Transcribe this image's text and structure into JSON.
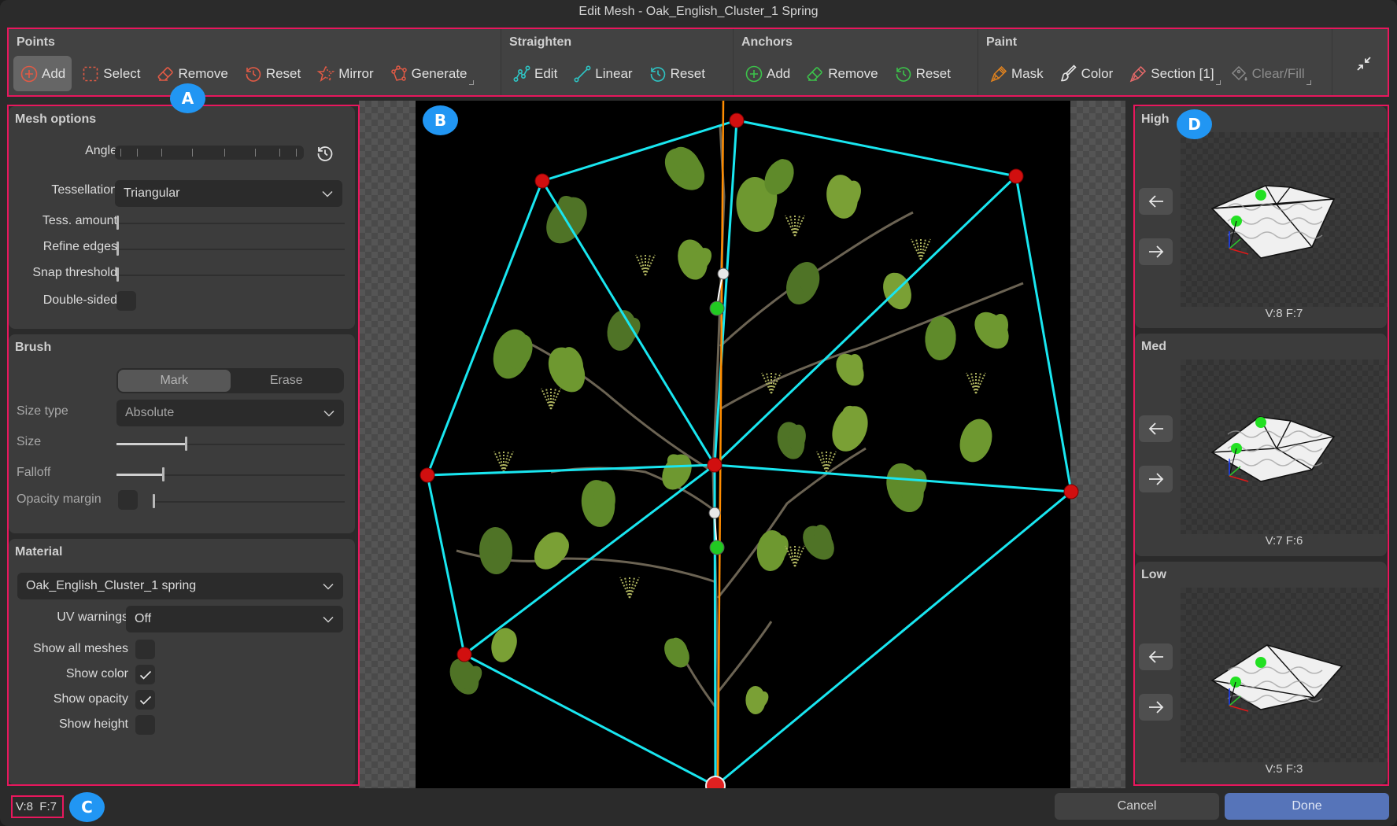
{
  "window": {
    "title": "Edit Mesh - Oak_English_Cluster_1 Spring"
  },
  "toolbar": {
    "groups": [
      {
        "title": "Points",
        "color": "#e05a45",
        "buttons": [
          {
            "label": "Add",
            "icon": "plus-circle-icon",
            "active": true
          },
          {
            "label": "Select",
            "icon": "dashed-select-icon"
          },
          {
            "label": "Remove",
            "icon": "eraser-icon"
          },
          {
            "label": "Reset",
            "icon": "history-icon"
          },
          {
            "label": "Mirror",
            "icon": "mirror-star-icon"
          },
          {
            "label": "Generate",
            "icon": "polygon-nodes-icon",
            "has_menu": true
          }
        ]
      },
      {
        "title": "Straighten",
        "color": "#2ec4c4",
        "buttons": [
          {
            "label": "Edit",
            "icon": "curve-nodes-icon"
          },
          {
            "label": "Linear",
            "icon": "line-nodes-icon"
          },
          {
            "label": "Reset",
            "icon": "history-icon"
          }
        ]
      },
      {
        "title": "Anchors",
        "color": "#3cc24a",
        "buttons": [
          {
            "label": "Add",
            "icon": "plus-circle-icon"
          },
          {
            "label": "Remove",
            "icon": "eraser-icon"
          },
          {
            "label": "Reset",
            "icon": "history-icon"
          }
        ]
      },
      {
        "title": "Paint",
        "buttons": [
          {
            "label": "Mask",
            "icon": "brush-icon",
            "color": "#e0821e"
          },
          {
            "label": "Color",
            "icon": "pen-brush-icon",
            "color": "#e8e8e8"
          },
          {
            "label": "Section [1]",
            "icon": "brush-icon",
            "color": "#e86a6a",
            "has_menu": true
          },
          {
            "label": "Clear/Fill",
            "icon": "paint-bucket-icon",
            "color": "#8a8a8a",
            "disabled": true,
            "has_menu": true
          }
        ]
      }
    ],
    "collapse_icon": "collapse-arrows-icon"
  },
  "badges": {
    "a": "A",
    "b": "B",
    "c": "C",
    "d": "D"
  },
  "mesh_options": {
    "title": "Mesh options",
    "angle_label": "Angle",
    "tessellation_label": "Tessellation",
    "tessellation_value": "Triangular",
    "tess_amount_label": "Tess. amount",
    "tess_amount_value": 0,
    "refine_edges_label": "Refine edges",
    "refine_edges_value": 0,
    "snap_threshold_label": "Snap threshold",
    "snap_threshold_value": 0,
    "double_sided_label": "Double-sided",
    "double_sided_checked": false
  },
  "brush": {
    "title": "Brush",
    "modes": [
      "Mark",
      "Erase"
    ],
    "active_mode": "Mark",
    "size_type_label": "Size type",
    "size_type_value": "Absolute",
    "size_label": "Size",
    "size_value": 0.3,
    "falloff_label": "Falloff",
    "falloff_value": 0.2,
    "opacity_margin_label": "Opacity margin",
    "opacity_margin_value": 0.0
  },
  "material": {
    "title": "Material",
    "material_value": "Oak_English_Cluster_1 spring",
    "uv_warnings_label": "UV warnings",
    "uv_warnings_value": "Off",
    "checkboxes": [
      {
        "label": "Show all meshes",
        "checked": false
      },
      {
        "label": "Show color",
        "checked": true
      },
      {
        "label": "Show opacity",
        "checked": true
      },
      {
        "label": "Show height",
        "checked": false
      }
    ]
  },
  "lods": [
    {
      "title": "High",
      "stats": "V:8  F:7"
    },
    {
      "title": "Med",
      "stats": "V:7  F:6"
    },
    {
      "title": "Low",
      "stats": "V:5  F:3"
    }
  ],
  "status": {
    "stats": "V:8  F:7"
  },
  "footer": {
    "cancel_label": "Cancel",
    "done_label": "Done"
  },
  "colors": {
    "accent": "#5674b9",
    "highlight": "#e8175d",
    "mesh_edge": "#19e6f0",
    "vertex": "#d10f0f",
    "anchor": "#22c922",
    "axis": "#ff8c00"
  }
}
